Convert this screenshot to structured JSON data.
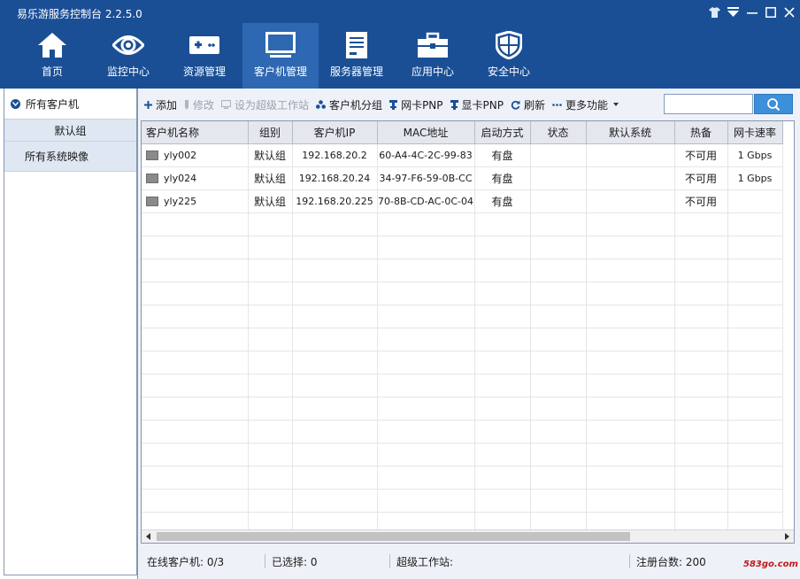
{
  "app": {
    "title": "易乐游服务控制台 2.2.5.0"
  },
  "nav": [
    {
      "label": "首页",
      "icon": "home-icon"
    },
    {
      "label": "监控中心",
      "icon": "eye-icon"
    },
    {
      "label": "资源管理",
      "icon": "gamepad-icon"
    },
    {
      "label": "客户机管理",
      "icon": "monitor-icon",
      "active": true
    },
    {
      "label": "服务器管理",
      "icon": "server-icon"
    },
    {
      "label": "应用中心",
      "icon": "toolbox-icon"
    },
    {
      "label": "安全中心",
      "icon": "shield-icon"
    }
  ],
  "sidebar": {
    "all_clients": "所有客户机",
    "default_group": "默认组",
    "all_images": "所有系统映像"
  },
  "toolbar": {
    "add": "添加",
    "edit": "修改",
    "set_super": "设为超级工作站",
    "client_group": "客户机分组",
    "nic_pnp": "网卡PNP",
    "gpu_pnp": "显卡PNP",
    "refresh": "刷新",
    "more": "更多功能",
    "search_value": ""
  },
  "table": {
    "columns": [
      "客户机名称",
      "组别",
      "客户机IP",
      "MAC地址",
      "启动方式",
      "状态",
      "默认系统",
      "热备",
      "网卡速率"
    ],
    "rows": [
      {
        "name": "yly002",
        "group": "默认组",
        "ip": "192.168.20.2",
        "mac": "60-A4-4C-2C-99-83",
        "boot": "有盘",
        "status": "",
        "default_os": "",
        "hot_standby": "不可用",
        "nic_speed": "1 Gbps"
      },
      {
        "name": "yly024",
        "group": "默认组",
        "ip": "192.168.20.24",
        "mac": "34-97-F6-59-0B-CC",
        "boot": "有盘",
        "status": "",
        "default_os": "",
        "hot_standby": "不可用",
        "nic_speed": "1 Gbps"
      },
      {
        "name": "yly225",
        "group": "默认组",
        "ip": "192.168.20.225",
        "mac": "70-8B-CD-AC-0C-04",
        "boot": "有盘",
        "status": "",
        "default_os": "",
        "hot_standby": "不可用",
        "nic_speed": ""
      }
    ]
  },
  "status": {
    "online": "在线客户机: 0/3",
    "selected": "已选择: 0",
    "super": "超级工作站:",
    "registered": "注册台数: 200"
  },
  "watermark": "583go.com",
  "colors": {
    "nav_bg": "#1a4f96",
    "nav_active": "#2e68b2",
    "search_button": "#3c8fd9",
    "panel_bg": "#eef2f8"
  }
}
